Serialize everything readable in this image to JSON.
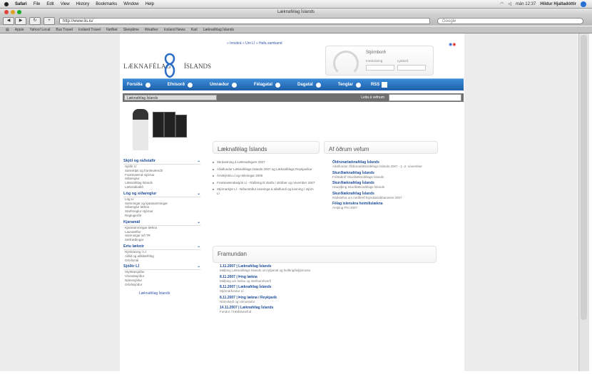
{
  "menubar": {
    "app": "Safari",
    "items": [
      "File",
      "Edit",
      "View",
      "History",
      "Bookmarks",
      "Window",
      "Help"
    ],
    "clock": "mán 12:37",
    "user": "Hildur Hjaltadóttir"
  },
  "window": {
    "title": "Læknafélag Íslands"
  },
  "toolbar": {
    "url": "http://www.lis.is/",
    "search_placeholder": "Google"
  },
  "bookmarks": [
    "Apple",
    "Yahoo! Local",
    "Bus Travel",
    "Iceland Travel",
    "NetNet",
    "Sleeptime",
    "Weather",
    "Iceland News",
    "Karl",
    "Læknafélag Íslands"
  ],
  "site": {
    "logo_left": "LÆKNAFÉLAG",
    "logo_right": "ÍSLANDS",
    "top_note": "» Innskrá » Um LÍ » Hafa samband",
    "weather_title": "Stjórnborð",
    "weather_label_1": "Innskráning",
    "weather_label_2": "Lykilorð",
    "nav": [
      "Forsíða",
      "Efnisorð",
      "Umræður",
      "Félagatal",
      "Dagatal",
      "Tenglar",
      "RSS"
    ],
    "subnav_select": "Læknafélag Íslands",
    "subnav_search_label": "Leita á vefnum"
  },
  "sidebar": [
    {
      "title": "Skjöl og ráðstafir",
      "items": [
        "Sjóðir LÍ",
        "Samskipti og framkvæmdir",
        "Framkvæmd stjórnar",
        "Siðareglur",
        "Læknafélag Íslands",
        "Læknablaðið"
      ]
    },
    {
      "title": "Lög og siðareglur",
      "items": [
        "Lög LÍ",
        "Samningar og kjarasamningar",
        "Siðareglur lækna",
        "Starfsreglur stjórnar",
        "Reglugerðir"
      ]
    },
    {
      "title": "Kjaramál",
      "items": [
        "Kjarasamningar lækna",
        "Launatöflur",
        "Samningar við TR",
        "Sérfræðingar"
      ]
    },
    {
      "title": "Ertu læknir",
      "items": [
        "Nýskráning í LÍ",
        "Aðild og aðildarfélög",
        "Orlofsmál"
      ]
    },
    {
      "title": "Sjóðir LÍ",
      "items": [
        "Styrktarsjóður",
        "Vísindasjóður",
        "Námssjóður",
        "Orlofssjóður"
      ]
    }
  ],
  "sidebar_link": "Læknafélag Íslands",
  "news": {
    "heading": "Læknafélag Íslands",
    "items": [
      "Skrásetning á Læknadögum 2007",
      "Aðalfundur Læknafélags Íslands 2007 og Læknafélags Reykjavíkur",
      "Ársskýrsla LÍ og reikningar 2006",
      "Framkvæmdastjóri LÍ - Ráðning til starfa í október og nóvember 2007",
      "Stjórnarkjör LÍ - Niðurstöður kosninga á aðalfundi og kosning í stjórn LÍ"
    ]
  },
  "other": {
    "heading": "Af öðrum vefum",
    "items": [
      {
        "title": "Öldrunarlæknafélag Íslands",
        "desc": "Aðalfundur Öldrunarlæknafélags Íslands 2007 - 1.-2. nóvember"
      },
      {
        "title": "Skurðlæknafélag Íslands",
        "desc": "Fréttabréf Skurðlæknafélags Íslands"
      },
      {
        "title": "Skurðlæknafélag Íslands",
        "desc": "Haustþing Skurðlæknafélags Íslands"
      },
      {
        "title": "Skurðlæknafélag Íslands",
        "desc": "Ráðstefna um meðferð brjóstakrabbameins 2007"
      },
      {
        "title": "Félag íslenskra heimilislækna",
        "desc": "Ársþing FÍH 2007"
      }
    ]
  },
  "events": {
    "heading": "Framundan",
    "items": [
      {
        "title": "1.11.2007 | Læknafélag Íslands",
        "desc": "Málþing Læknafélags Íslands um lyfjamál og heilbrigðisþjónustu"
      },
      {
        "title": "8.11.2007 | Þing lækna",
        "desc": "Málþing um heilsu og starfsumhverfi"
      },
      {
        "title": "8.11.2007 | Læknafélag Íslands",
        "desc": "Stjórnarfundur LÍ"
      },
      {
        "title": "8.11.2007 | Þing lækna í Reykjavík",
        "desc": "Námskeið og vinnustofur"
      },
      {
        "title": "14.11.2007 | Læknafélag Íslands",
        "desc": "Fundur í fræðslunefnd"
      }
    ]
  }
}
